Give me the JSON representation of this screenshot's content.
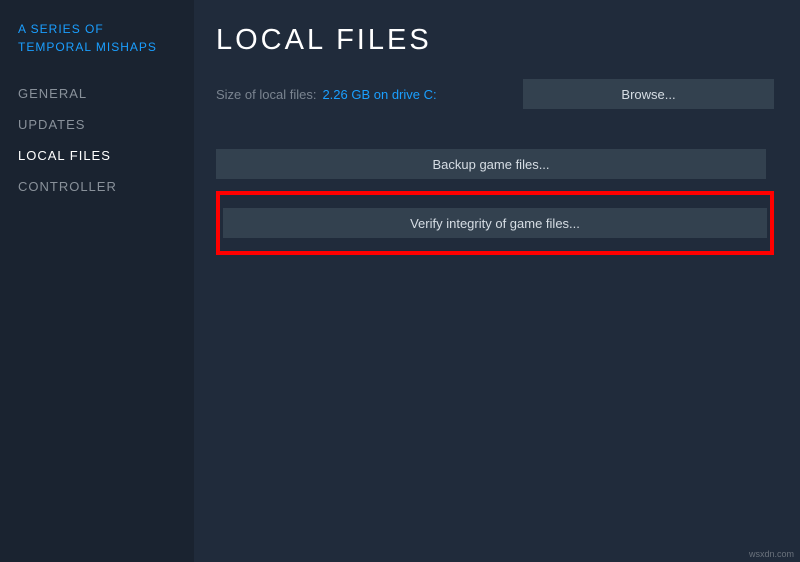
{
  "sidebar": {
    "gameTitle": "A SERIES OF TEMPORAL MISHAPS",
    "items": [
      {
        "label": "GENERAL",
        "active": false
      },
      {
        "label": "UPDATES",
        "active": false
      },
      {
        "label": "LOCAL FILES",
        "active": true
      },
      {
        "label": "CONTROLLER",
        "active": false
      }
    ]
  },
  "main": {
    "heading": "LOCAL FILES",
    "sizeLabel": "Size of local files:",
    "sizeValue": "2.26 GB on drive C:",
    "browse": "Browse...",
    "backup": "Backup game files...",
    "verify": "Verify integrity of game files..."
  },
  "close": "✕",
  "watermark": "wsxdn.com"
}
